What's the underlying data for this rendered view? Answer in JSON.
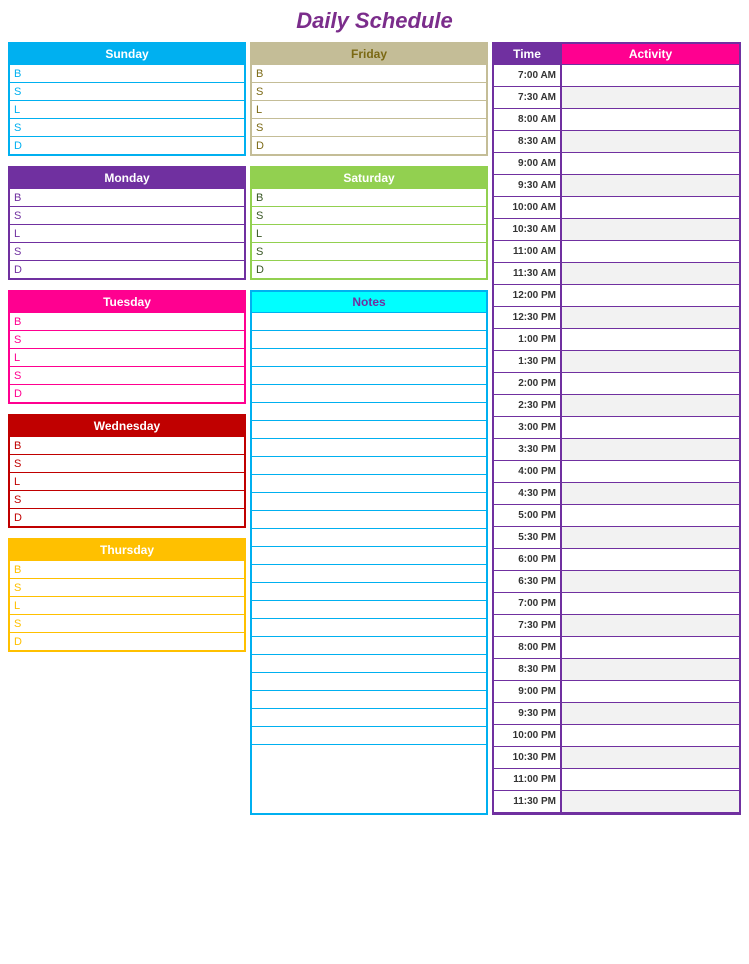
{
  "title": "Daily Schedule",
  "days": {
    "sunday": {
      "label": "Sunday",
      "rows": [
        "B",
        "S",
        "L",
        "S",
        "D"
      ]
    },
    "monday": {
      "label": "Monday",
      "rows": [
        "B",
        "S",
        "L",
        "S",
        "D"
      ]
    },
    "tuesday": {
      "label": "Tuesday",
      "rows": [
        "B",
        "S",
        "L",
        "S",
        "D"
      ]
    },
    "wednesday": {
      "label": "Wednesday",
      "rows": [
        "B",
        "S",
        "L",
        "S",
        "D"
      ]
    },
    "thursday": {
      "label": "Thursday",
      "rows": [
        "B",
        "S",
        "L",
        "S",
        "D"
      ]
    },
    "friday": {
      "label": "Friday",
      "rows": [
        "B",
        "S",
        "L",
        "S",
        "D"
      ]
    },
    "saturday": {
      "label": "Saturday",
      "rows": [
        "B",
        "S",
        "L",
        "S",
        "D"
      ]
    }
  },
  "notes": {
    "label": "Notes",
    "row_count": 20
  },
  "schedule": {
    "time_header": "Time",
    "activity_header": "Activity",
    "times": [
      "7:00 AM",
      "7:30 AM",
      "8:00 AM",
      "8:30 AM",
      "9:00 AM",
      "9:30 AM",
      "10:00 AM",
      "10:30 AM",
      "11:00 AM",
      "11:30 AM",
      "12:00 PM",
      "12:30 PM",
      "1:00 PM",
      "1:30 PM",
      "2:00 PM",
      "2:30 PM",
      "3:00 PM",
      "3:30 PM",
      "4:00 PM",
      "4:30 PM",
      "5:00 PM",
      "5:30 PM",
      "6:00 PM",
      "6:30 PM",
      "7:00 PM",
      "7:30 PM",
      "8:00 PM",
      "8:30 PM",
      "9:00 PM",
      "9:30 PM",
      "10:00 PM",
      "10:30 PM",
      "11:00 PM",
      "11:30 PM"
    ]
  }
}
